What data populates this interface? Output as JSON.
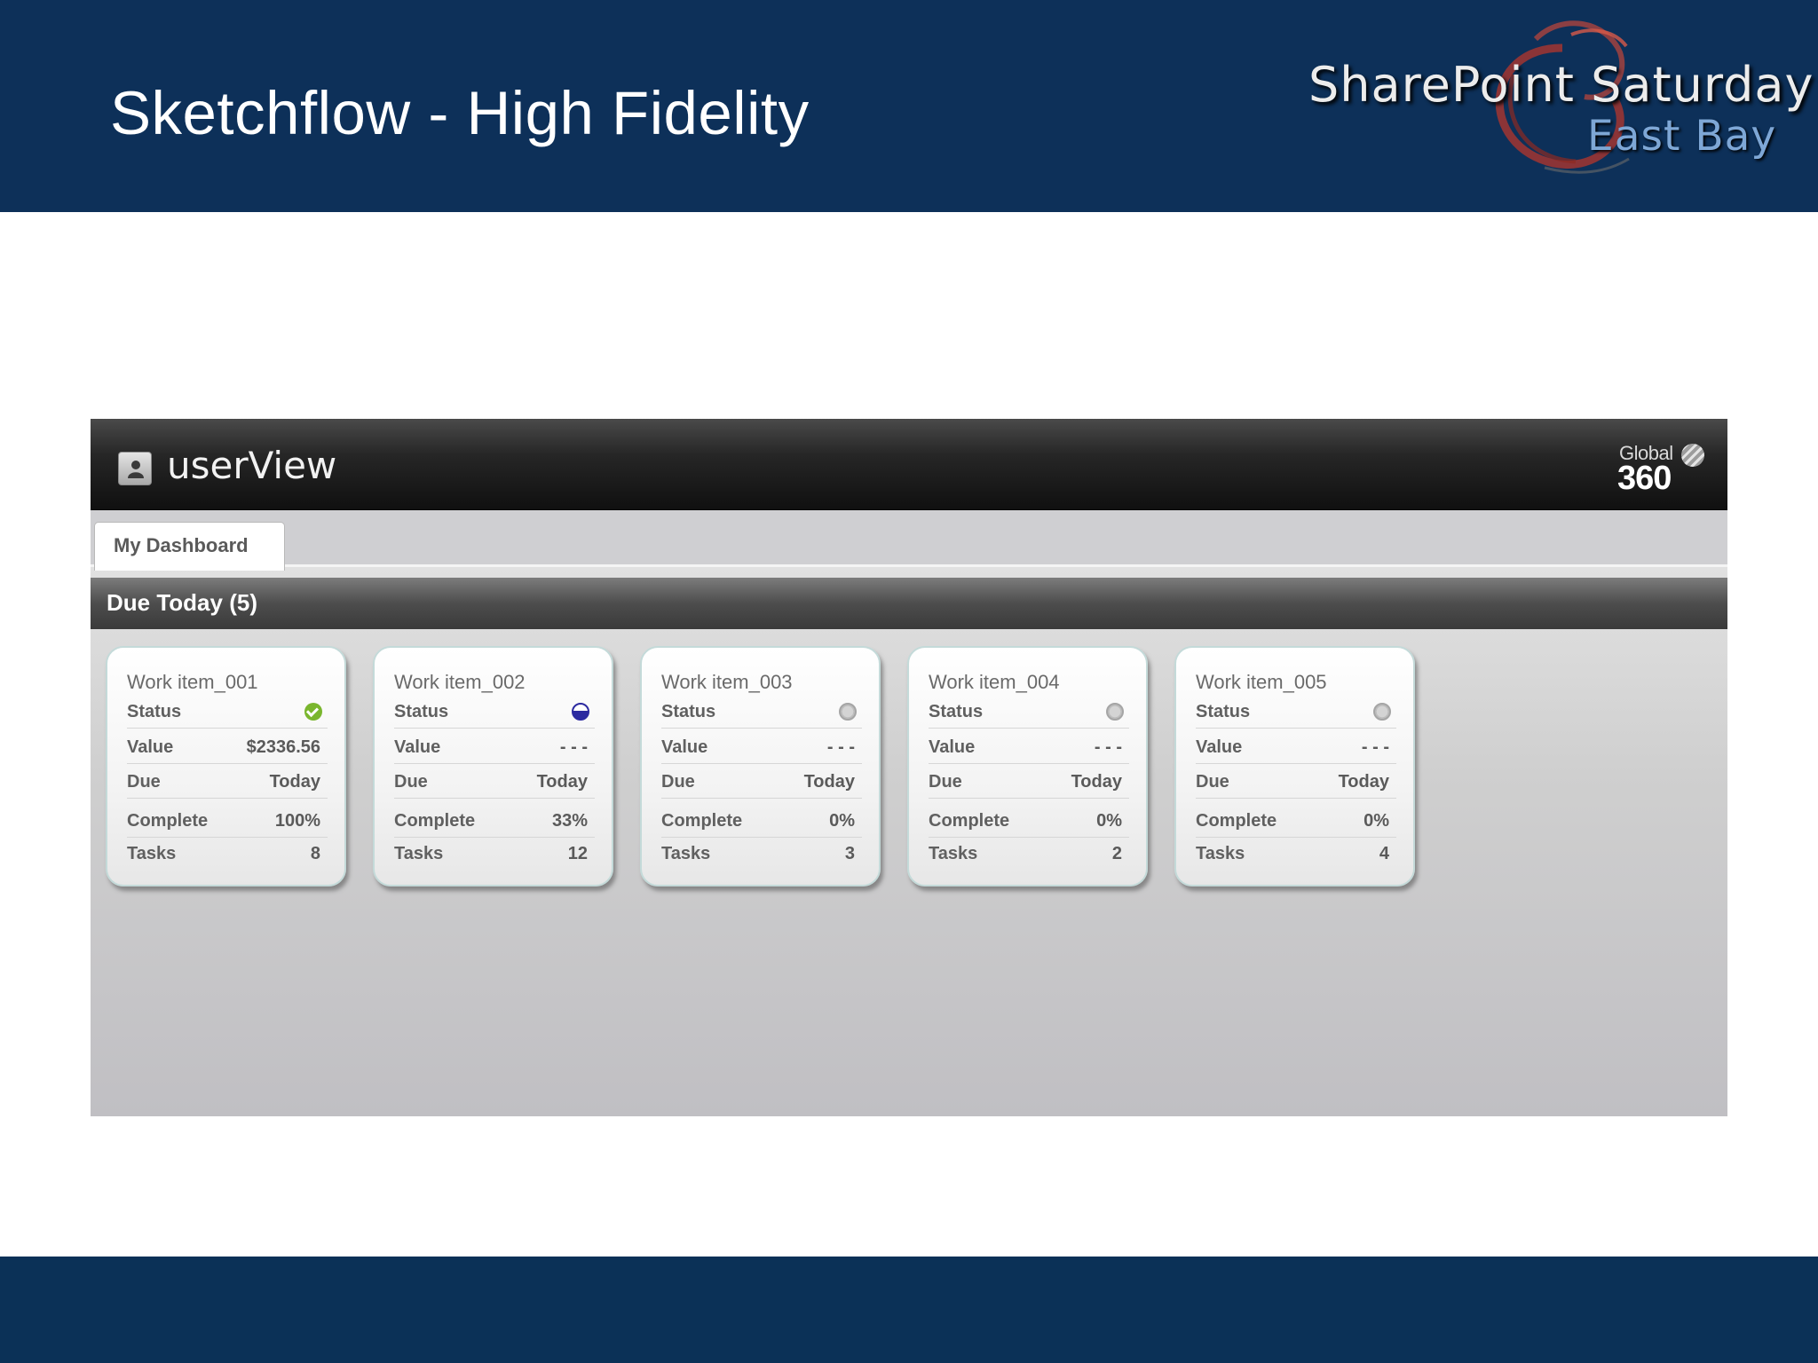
{
  "slide": {
    "title": "Sketchflow - High Fidelity",
    "logo": {
      "line1": "SharePoint Saturday",
      "line2": "East Bay",
      "accent_color": "#c0392b"
    },
    "header_color": "#0d3059",
    "footer_color": "#0b3157"
  },
  "app": {
    "title": "userView",
    "icon": "user-icon",
    "brand": {
      "line1": "Global",
      "line2": "360",
      "icon": "globe-icon"
    },
    "tabs": [
      {
        "label": "My Dashboard",
        "active": true
      }
    ],
    "section": {
      "title": "Due Today (5)"
    },
    "cards": [
      {
        "title": "Work item_001",
        "status": "complete",
        "status_icon": "check-circle-icon",
        "status_color": "#7ab62e",
        "rows": {
          "status": "Status",
          "value": "Value",
          "due": "Due",
          "complete": "Complete",
          "tasks": "Tasks"
        },
        "value": "$2336.56",
        "due": "Today",
        "complete": "100%",
        "tasks": "8"
      },
      {
        "title": "Work item_002",
        "status": "in-progress",
        "status_icon": "half-circle-icon",
        "status_color": "#2c2aa0",
        "rows": {
          "status": "Status",
          "value": "Value",
          "due": "Due",
          "complete": "Complete",
          "tasks": "Tasks"
        },
        "value": "- - -",
        "due": "Today",
        "complete": "33%",
        "tasks": "12"
      },
      {
        "title": "Work item_003",
        "status": "not-started",
        "status_icon": "empty-circle-icon",
        "status_color": "#bdbdbd",
        "rows": {
          "status": "Status",
          "value": "Value",
          "due": "Due",
          "complete": "Complete",
          "tasks": "Tasks"
        },
        "value": "- - -",
        "due": "Today",
        "complete": "0%",
        "tasks": "3"
      },
      {
        "title": "Work item_004",
        "status": "not-started",
        "status_icon": "empty-circle-icon",
        "status_color": "#bdbdbd",
        "rows": {
          "status": "Status",
          "value": "Value",
          "due": "Due",
          "complete": "Complete",
          "tasks": "Tasks"
        },
        "value": "- - -",
        "due": "Today",
        "complete": "0%",
        "tasks": "2"
      },
      {
        "title": "Work item_005",
        "status": "not-started",
        "status_icon": "empty-circle-icon",
        "status_color": "#bdbdbd",
        "rows": {
          "status": "Status",
          "value": "Value",
          "due": "Due",
          "complete": "Complete",
          "tasks": "Tasks"
        },
        "value": "- - -",
        "due": "Today",
        "complete": "0%",
        "tasks": "4"
      }
    ]
  }
}
